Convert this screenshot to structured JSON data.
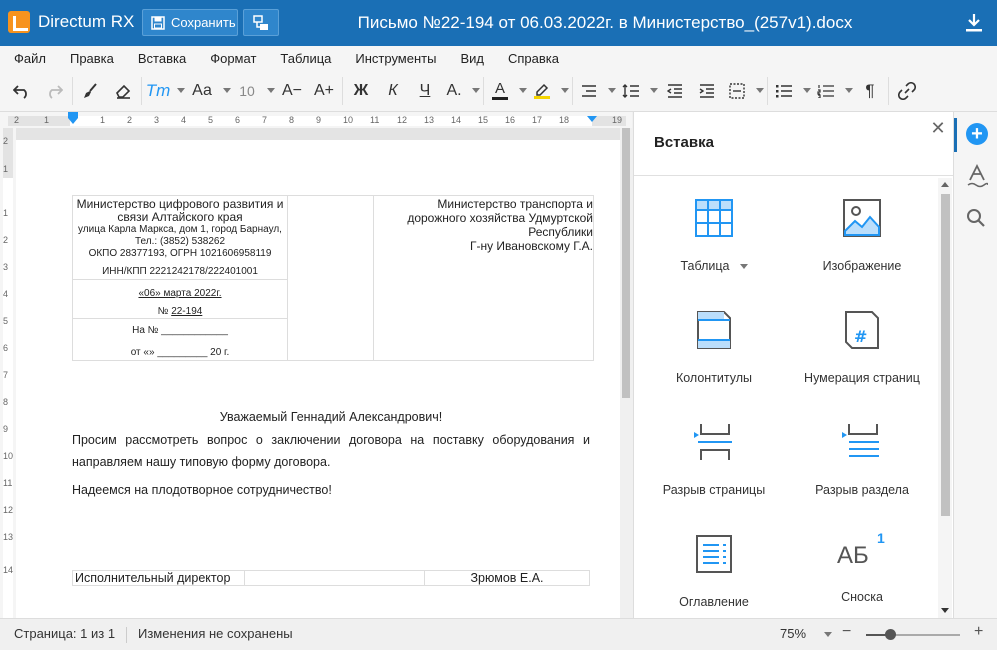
{
  "app": {
    "name": "Directum RX",
    "save_label": "Сохранить",
    "doc_title": "Письмо №22-194 от 06.03.2022г. в Министерство_(257v1).docx"
  },
  "menu": [
    "Файл",
    "Правка",
    "Вставка",
    "Формат",
    "Таблица",
    "Инструменты",
    "Вид",
    "Справка"
  ],
  "toolbar": {
    "font_size": "10",
    "bold": "Ж",
    "italic": "К",
    "underline": "Ч",
    "strike": "А.",
    "font_color_letter": "А",
    "font_color": "#222222",
    "highlight_color": "#f5d400",
    "styles_letter": "Тт",
    "case_letter": "Аа",
    "decrease_font": "А−",
    "increase_font": "А+",
    "paragraph_mark": "¶"
  },
  "ruler": {
    "numbers": [
      "2",
      "1",
      "1",
      "2",
      "3",
      "4",
      "5",
      "6",
      "7",
      "8",
      "9",
      "10",
      "11",
      "12",
      "13",
      "14",
      "15",
      "16",
      "17",
      "18",
      "19"
    ],
    "vnumbers": [
      "2",
      "1",
      "1",
      "2",
      "3",
      "4",
      "5",
      "6",
      "7",
      "8",
      "9",
      "10",
      "11",
      "12",
      "13",
      "14"
    ]
  },
  "document": {
    "sender": {
      "org": "Министерство цифрового развития и связи Алтайского края",
      "address": "улица Карла Маркса, дом 1, город Барнаул,",
      "phone": "Тел.: (3852) 538262",
      "okpo": "ОКПО 28377193, ОГРН 1021606958119",
      "inn": "ИНН/КПП 2221242178/222401001",
      "date": "«06» марта 2022г.",
      "number_prefix": "№",
      "number": "22-194",
      "ref_no": "На № ____________",
      "ref_from": "от «» _________ 20  г."
    },
    "recipient": {
      "line1": "Министерство транспорта и",
      "line2": "дорожного хозяйства Удмуртской",
      "line3": "Республики",
      "line4": "Г-ну Ивановскому Г.А."
    },
    "salutation": "Уважаемый Геннадий Александрович!",
    "paragraph1": "Просим рассмотреть вопрос о заключении договора на поставку оборудования и направляем нашу типовую форму договора.",
    "paragraph2": "Надеемся на плодотворное сотрудничество!",
    "signer_title": "Исполнительный директор",
    "signer_name": "Зрюмов Е.А."
  },
  "panel": {
    "title": "Вставка",
    "items": [
      {
        "label": "Таблица",
        "icon": "table-icon",
        "has_dropdown": true
      },
      {
        "label": "Изображение",
        "icon": "image-icon"
      },
      {
        "label": "Колонтитулы",
        "icon": "header-footer-icon"
      },
      {
        "label": "Нумерация страниц",
        "icon": "page-number-icon"
      },
      {
        "label": "Разрыв страницы",
        "icon": "page-break-icon"
      },
      {
        "label": "Разрыв раздела",
        "icon": "section-break-icon"
      },
      {
        "label": "Оглавление",
        "icon": "toc-icon"
      },
      {
        "label": "Сноска",
        "icon": "footnote-icon",
        "glyph": "АБ",
        "superscript": "1"
      }
    ]
  },
  "status": {
    "page": "Страница: 1 из 1",
    "save_state": "Изменения не сохранены",
    "zoom": "75%",
    "zoom_level": 0.25
  },
  "colors": {
    "accent": "#1a6fb5",
    "icon_blue": "#2196f3"
  }
}
